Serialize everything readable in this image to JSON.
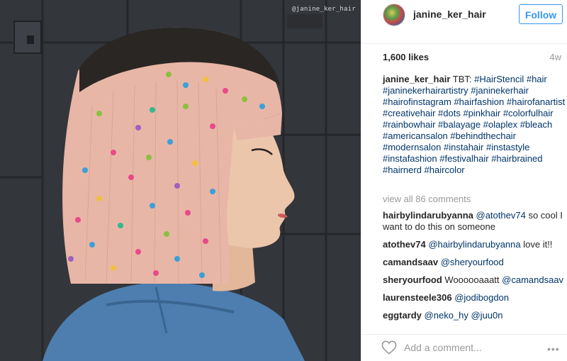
{
  "photo": {
    "watermark": "@janine_ker_hair",
    "colors": {
      "wall": "#34373c",
      "hair_root": "#2a2624",
      "hair": "#e8b8a8",
      "skin": "#e8c0a4",
      "jacket": "#4f7fb0",
      "dots": [
        "#e84a8a",
        "#3aa0d8",
        "#8ac040",
        "#f0c040",
        "#a060c0",
        "#2fb890"
      ]
    }
  },
  "post": {
    "username": "janine_ker_hair",
    "follow_label": "Follow",
    "likes": "1,600 likes",
    "time": "4w"
  },
  "caption": {
    "user": "janine_ker_hair",
    "text": "TBT:",
    "hashtags": "#HairStencil #hair #janinekerhairartistry #janinekerhair #hairofinstagram #hairfashion #hairofanartist #creativehair #dots #pinkhair #colorfulhair #rainbowhair #balayage #olaplex #bleach #americansalon #behindthechair #modernsalon #instahair #instastyle #instafashion #festivalhair #hairbrained #hairnerd #haircolor"
  },
  "view_all_comments": "view all 86 comments",
  "comments": [
    {
      "user": "hairbylindarubyanna",
      "mention": "@atothev74",
      "text": "so cool I want to do this on someone"
    },
    {
      "user": "atothev74",
      "mention": "@hairbylindarubyanna",
      "text": "love it!!"
    },
    {
      "user": "camandsaav",
      "mention": "@sheryourfood",
      "text": ""
    },
    {
      "user": "sheryourfood",
      "mention": "@camandsaav",
      "text": "Woooooaaatt",
      "mention_after": true
    },
    {
      "user": "laurensteele306",
      "mention": "@jodibogdon",
      "text": ""
    },
    {
      "user": "eggtardy",
      "mention": "@neko_hy @juu0n",
      "text": ""
    }
  ],
  "footer": {
    "comment_placeholder": "Add a comment...",
    "like_icon": "heart-icon",
    "more_icon": "more-options-icon"
  }
}
